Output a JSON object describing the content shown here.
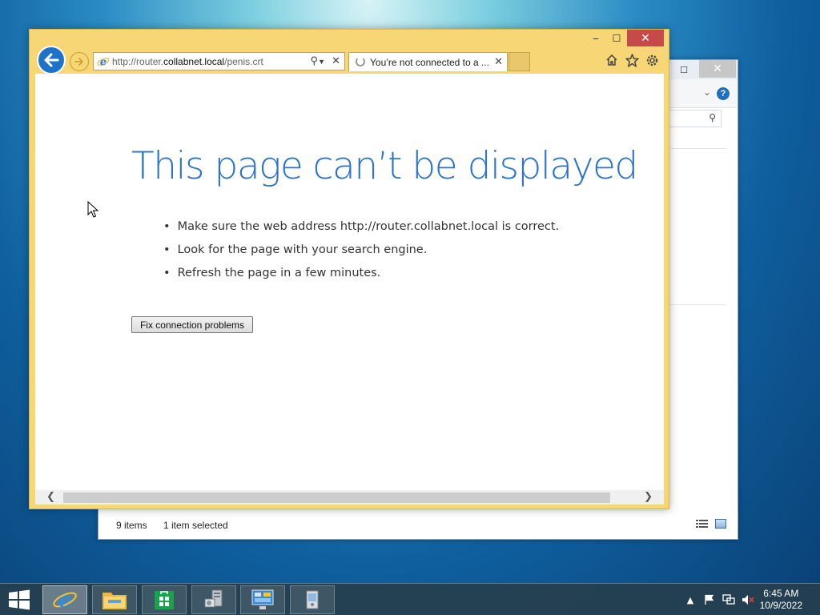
{
  "explorer": {
    "status_items": "9 items",
    "status_selected": "1 item selected"
  },
  "ie": {
    "window_controls": {
      "minimize": "‒",
      "maximize": "☐",
      "close": "✕"
    },
    "address": {
      "prefix": "http://router.",
      "domain": "collabnet.local",
      "path": "/penis.crt"
    },
    "tab": {
      "title": "You’re not connected to a ..."
    },
    "error": {
      "title": "This page can’t be displayed",
      "bullets": [
        "Make sure the web address http://router.collabnet.local is correct.",
        "Look for the page with your search engine.",
        "Refresh the page in a few minutes."
      ],
      "fix_button": "Fix connection problems"
    }
  },
  "taskbar": {
    "apps": [
      "internet-explorer",
      "file-explorer",
      "store",
      "server-manager",
      "control-panel",
      "remote-desktop"
    ],
    "time": "6:45 AM",
    "date": "10/9/2022"
  }
}
